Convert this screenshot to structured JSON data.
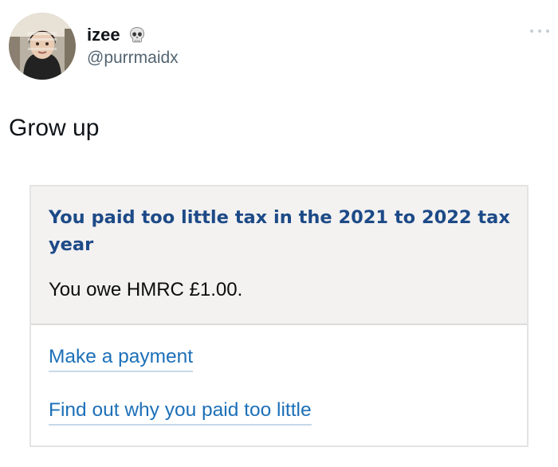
{
  "tweet": {
    "display_name": "izee",
    "name_emoji": "skull-icon",
    "handle": "@purrmaidx",
    "text": "Grow up",
    "more_icon": "more-options-icon"
  },
  "card": {
    "heading": "You paid too little tax in the 2021 to 2022 tax year",
    "body": "You owe HMRC £1.00.",
    "links": [
      {
        "label": "Make a payment"
      },
      {
        "label": "Find out why you paid too little"
      }
    ],
    "colors": {
      "heading": "#1d4a87",
      "link": "#1d70b8",
      "panel_background": "#f3f2f1"
    }
  }
}
